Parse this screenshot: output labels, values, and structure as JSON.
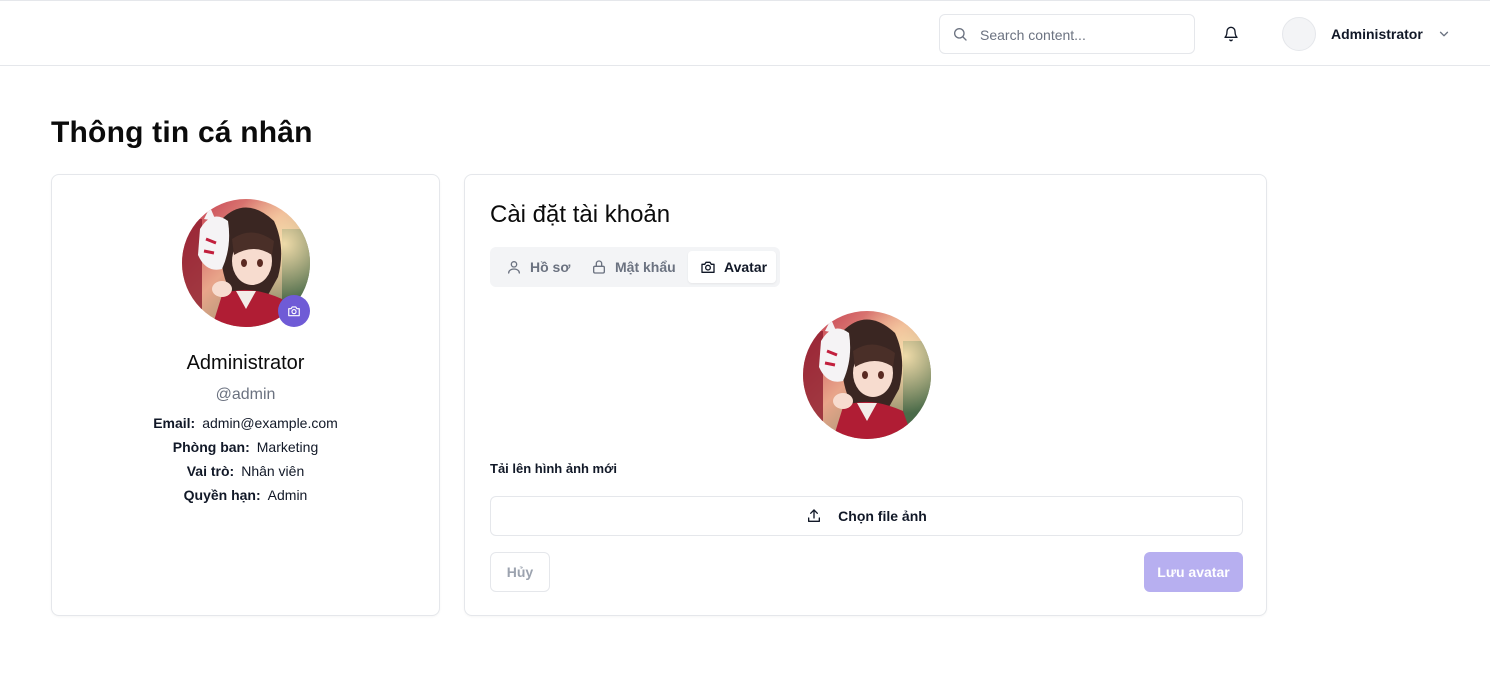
{
  "header": {
    "search": {
      "placeholder": "Search content..."
    },
    "user": {
      "name": "Administrator"
    }
  },
  "page": {
    "title": "Thông tin cá nhân"
  },
  "profile": {
    "name": "Administrator",
    "handle": "@admin",
    "details": [
      {
        "label": "Email:",
        "value": "admin@example.com"
      },
      {
        "label": "Phòng ban:",
        "value": "Marketing"
      },
      {
        "label": "Vai trò:",
        "value": "Nhân viên"
      },
      {
        "label": "Quyền hạn:",
        "value": "Admin"
      }
    ]
  },
  "settings": {
    "title": "Cài đặt tài khoản",
    "tabs": [
      {
        "label": "Hồ sơ",
        "icon": "user-icon",
        "active": false
      },
      {
        "label": "Mật khẩu",
        "icon": "lock-icon",
        "active": false
      },
      {
        "label": "Avatar",
        "icon": "camera-icon",
        "active": true
      }
    ],
    "upload_label": "Tải lên hình ảnh mới",
    "file_button": "Chọn file ảnh",
    "cancel_button": "Hủy",
    "save_button": "Lưu avatar"
  },
  "colors": {
    "accent": "#6f5bd6",
    "accent_disabled": "#b7aff0",
    "border": "#e5e7eb",
    "muted_text": "#6b7280"
  }
}
